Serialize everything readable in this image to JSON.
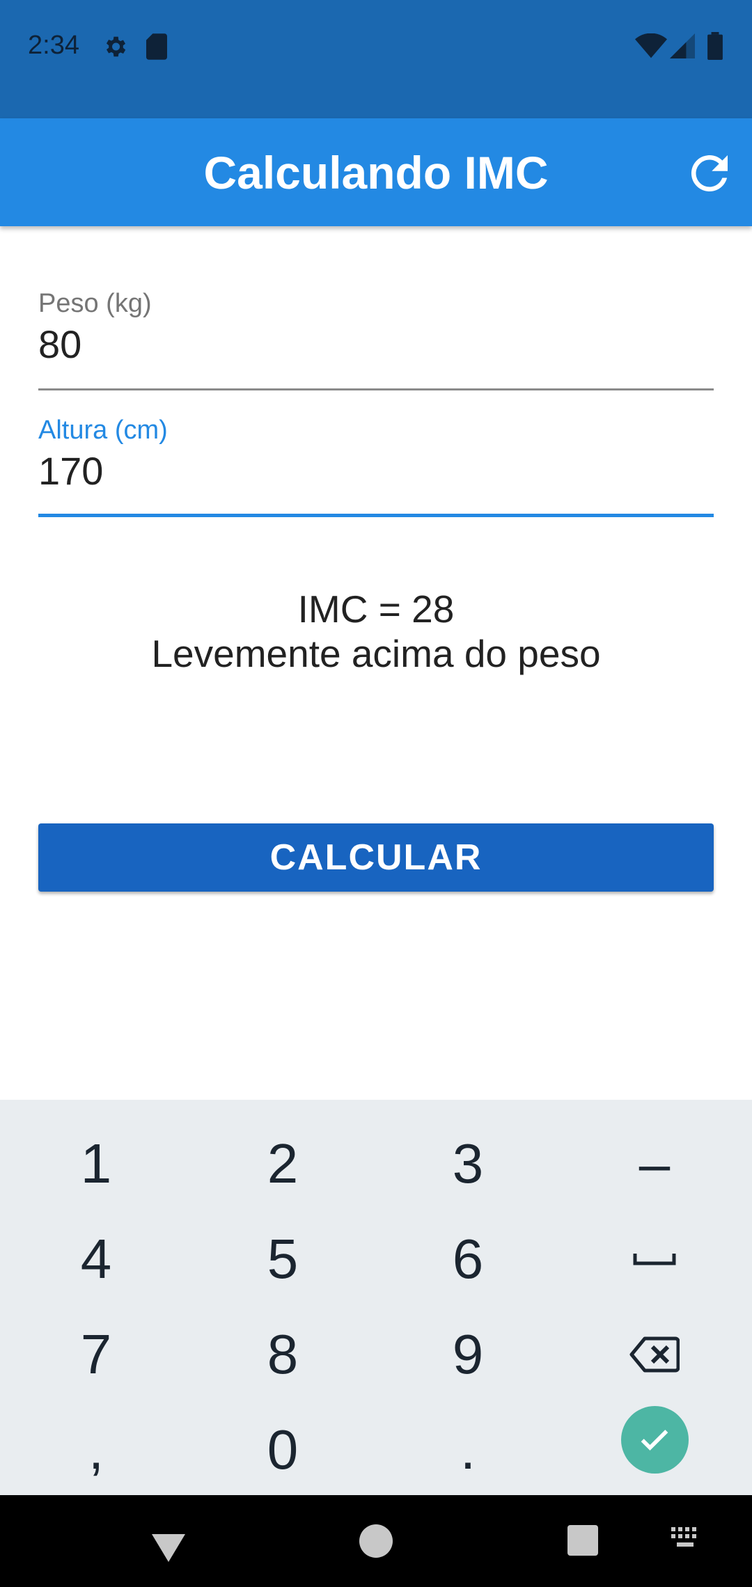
{
  "status_bar": {
    "time": "2:34",
    "icons": [
      "gear-icon",
      "sd-card-icon",
      "wifi-icon",
      "signal-icon",
      "battery-icon"
    ]
  },
  "app_bar": {
    "title": "Calculando IMC",
    "refresh_icon": "refresh-icon"
  },
  "form": {
    "weight": {
      "label": "Peso (kg)",
      "value": "80"
    },
    "height": {
      "label": "Altura (cm)",
      "value": "170"
    }
  },
  "result": {
    "imc_line": "IMC = 28",
    "category_line": "Levemente acima do peso"
  },
  "calculate_button": {
    "label": "CALCULAR"
  },
  "keyboard": {
    "rows": [
      [
        "1",
        "2",
        "3",
        "–"
      ],
      [
        "4",
        "5",
        "6",
        "space"
      ],
      [
        "7",
        "8",
        "9",
        "backspace"
      ],
      [
        ",",
        "0",
        ".",
        "done"
      ]
    ],
    "digits": {
      "k1": "1",
      "k2": "2",
      "k3": "3",
      "k4": "4",
      "k5": "5",
      "k6": "6",
      "k7": "7",
      "k8": "8",
      "k9": "9",
      "k0": "0",
      "comma": ",",
      "dot": ".",
      "minus": "–"
    }
  },
  "colors": {
    "status_bar": "#1b68b0",
    "app_bar": "#2389e3",
    "accent": "#2389e3",
    "button": "#1864c0",
    "keyboard_bg": "#e9edf0",
    "done_key": "#4db6a4"
  },
  "nav_bar": {
    "icons": [
      "back-icon",
      "home-icon",
      "recents-icon",
      "keyboard-switch-icon"
    ]
  }
}
